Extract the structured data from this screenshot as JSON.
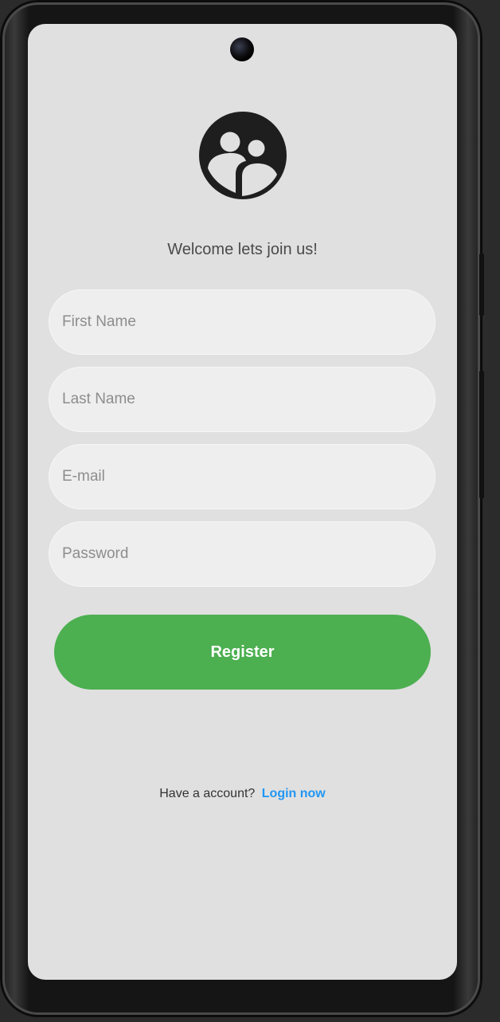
{
  "welcome_text": "Welcome lets join us!",
  "form": {
    "first_name_placeholder": "First Name",
    "last_name_placeholder": "Last Name",
    "email_placeholder": "E-mail",
    "password_placeholder": "Password",
    "register_label": "Register"
  },
  "footer": {
    "prompt": "Have a account?",
    "login_link": "Login now"
  },
  "icons": {
    "logo": "people-group-icon"
  },
  "colors": {
    "background": "#e0e0e0",
    "field": "#eeeeee",
    "primary_button": "#4caf50",
    "link": "#2196f3",
    "logo": "#1e1e1e"
  }
}
